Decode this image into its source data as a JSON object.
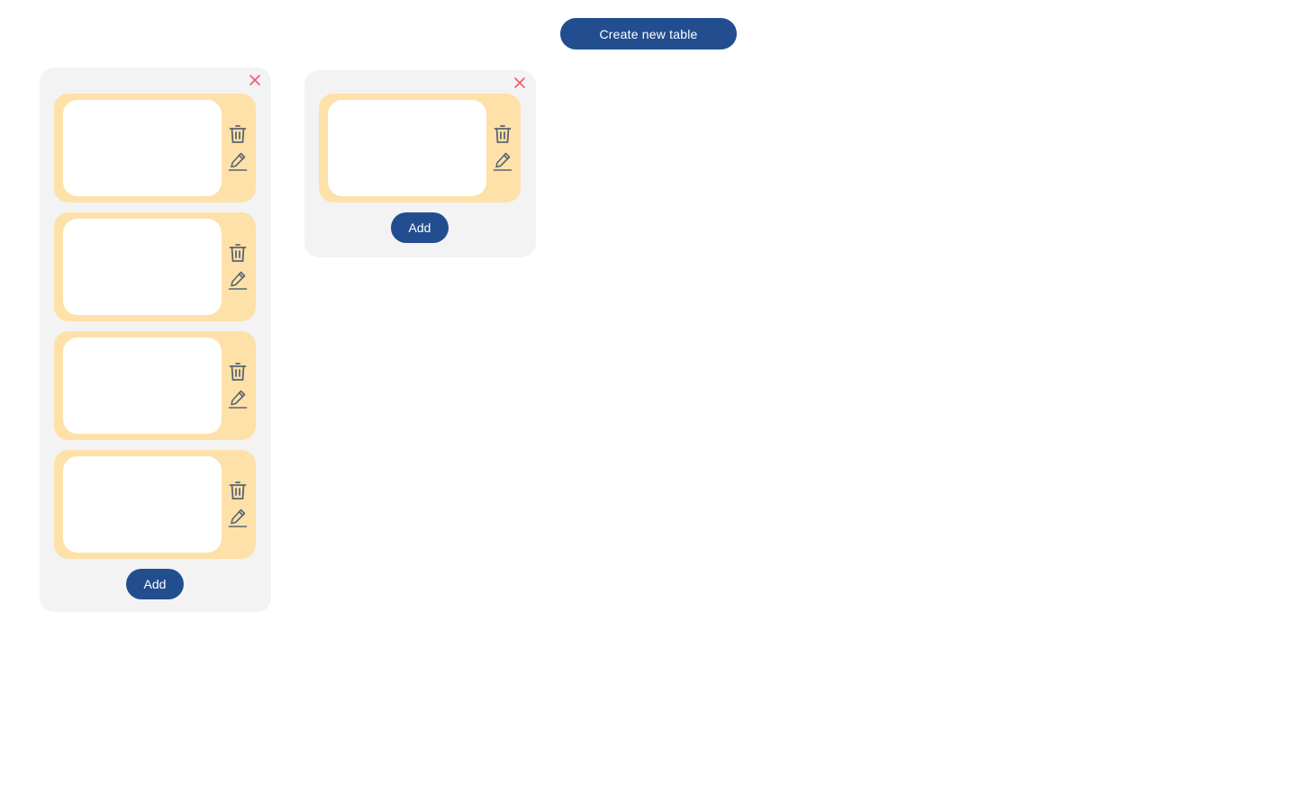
{
  "toolbar": {
    "create_label": "Create new table"
  },
  "icons": {
    "close": "close-icon",
    "delete": "trash-icon",
    "edit": "pencil-icon"
  },
  "colors": {
    "primary": "#224e90",
    "board_background": "#f3f3f3",
    "card_background": "#fde1a8",
    "close": "#f25a6a",
    "icon": "#5b6472"
  },
  "boards": [
    {
      "cards": [
        {},
        {},
        {},
        {}
      ],
      "add_label": "Add"
    },
    {
      "cards": [
        {}
      ],
      "add_label": "Add"
    }
  ]
}
